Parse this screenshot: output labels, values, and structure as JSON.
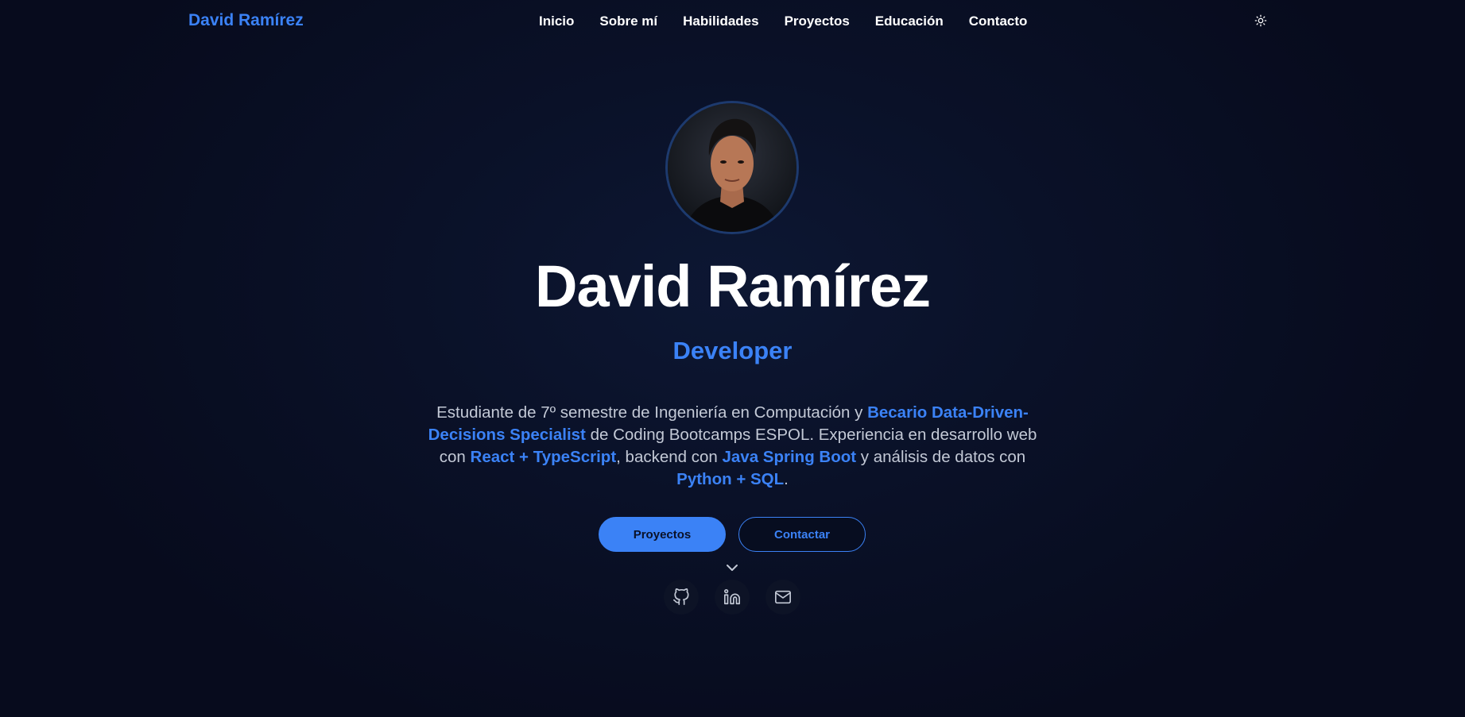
{
  "header": {
    "brand": "David Ramírez",
    "nav": [
      "Inicio",
      "Sobre mí",
      "Habilidades",
      "Proyectos",
      "Educación",
      "Contacto"
    ],
    "theme_toggle_icon": "sun-icon"
  },
  "hero": {
    "avatar_icon": "profile-photo",
    "name": "David Ramírez",
    "role": "Developer",
    "description": {
      "p1": "Estudiante de 7º semestre de Ingeniería en Computación y ",
      "h1": "Becario Data-Driven-Decisions Specialist",
      "p2": " de Coding Bootcamps ESPOL. Experiencia en desarrollo web con ",
      "h2": "React + TypeScript",
      "p3": ", backend con ",
      "h3": "Java Spring Boot",
      "p4": " y análisis de datos con ",
      "h4": "Python + SQL",
      "p5": "."
    },
    "buttons": {
      "primary": "Proyectos",
      "secondary": "Contactar"
    },
    "scroll_icon": "chevron-down-icon",
    "socials": [
      "github-icon",
      "linkedin-icon",
      "mail-icon"
    ]
  },
  "colors": {
    "accent": "#3b82f6",
    "background": "#0a1128",
    "text": "#ffffff",
    "muted": "#c3c9d6"
  }
}
